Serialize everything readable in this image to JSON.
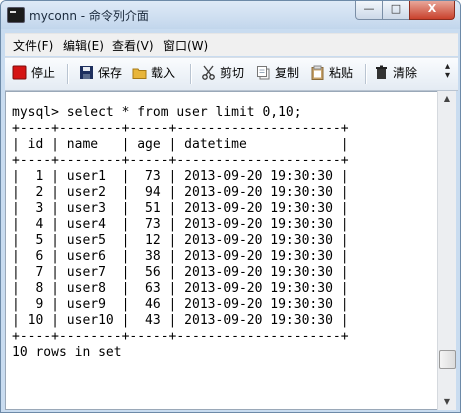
{
  "window": {
    "title": "myconn - 命令列介面",
    "controls": {
      "minimize": "—",
      "maximize": "□",
      "close": "X"
    }
  },
  "menu": {
    "items": [
      {
        "label": "文件(F)"
      },
      {
        "label": "编辑(E)"
      },
      {
        "label": "查看(V)"
      },
      {
        "label": "窗口(W)"
      }
    ]
  },
  "toolbar": {
    "stop": "停止",
    "save": "保存",
    "load": "载入",
    "cut": "剪切",
    "copy": "复制",
    "paste": "粘贴",
    "clear": "清除",
    "more": "▴\n▾",
    "icons": {
      "stop": "stop-icon",
      "save": "save-icon",
      "load": "folder-icon",
      "cut": "scissors-icon",
      "copy": "copy-icon",
      "paste": "clipboard-icon",
      "clear": "trash-icon"
    },
    "colors": {
      "stop": "#d51414",
      "save": "#1d2f5e",
      "folder": "#e8b53a"
    }
  },
  "console": {
    "command": "mysql> select * from user limit 0,10;",
    "border": "+----+--------+-----+---------------------+",
    "header": "| id | name   | age | datetime            |",
    "rows": [
      "|  1 | user1  |  73 | 2013-09-20 19:30:30 |",
      "|  2 | user2  |  94 | 2013-09-20 19:30:30 |",
      "|  3 | user3  |  51 | 2013-09-20 19:30:30 |",
      "|  4 | user4  |  73 | 2013-09-20 19:30:30 |",
      "|  5 | user5  |  12 | 2013-09-20 19:30:30 |",
      "|  6 | user6  |  38 | 2013-09-20 19:30:30 |",
      "|  7 | user7  |  56 | 2013-09-20 19:30:30 |",
      "|  8 | user8  |  63 | 2013-09-20 19:30:30 |",
      "|  9 | user9  |  46 | 2013-09-20 19:30:30 |",
      "| 10 | user10 |  43 | 2013-09-20 19:30:30 |"
    ],
    "footer": "10 rows in set"
  },
  "scrollbar": {
    "up": "▲",
    "down": "▼"
  }
}
